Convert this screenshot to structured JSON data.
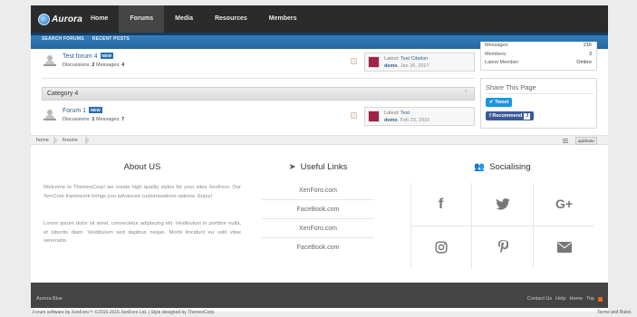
{
  "header": {
    "logo_text": "Aurora",
    "nav": [
      "Home",
      "Forums",
      "Media",
      "Resources",
      "Members"
    ],
    "active_nav": "Forums",
    "subnav": [
      "SEARCH FORUMS",
      "RECENT POSTS"
    ]
  },
  "forums": [
    {
      "title": "Test forum 4",
      "badge": "NEW",
      "discussions_label": "Discussions:",
      "discussions": "2",
      "messages_label": "Messages:",
      "messages": "4",
      "latest_label": "Latest:",
      "latest_thread": "Test Citation",
      "latest_user": "demo",
      "latest_date": "Jan 26, 2017"
    },
    {
      "title": "Forum 1",
      "badge": "NEW",
      "discussions_label": "Discussions:",
      "discussions": "1",
      "messages_label": "Messages:",
      "messages": "7",
      "latest_label": "Latest:",
      "latest_thread": "Test",
      "latest_user": "demo",
      "latest_date": "Feb 23, 2016"
    }
  ],
  "category": {
    "title": "Category 4"
  },
  "sidebar": {
    "stats": [
      {
        "label": "Messages:",
        "value": "216"
      },
      {
        "label": "Members:",
        "value": "3"
      },
      {
        "label": "Latest Member:",
        "value": "Ombre"
      }
    ],
    "share_title": "Share This Page",
    "tweet_label": "Tweet",
    "fb_label": "Recommend",
    "fb_count": "3"
  },
  "breadcrumb": {
    "items": [
      "home",
      "forums"
    ],
    "quicknav": "quicknav"
  },
  "about": {
    "title": "About US",
    "para1": "Welcome to ThemesCorp! we create high quality styles for your sites XenForo. Our XenCore framework brings you advanced customizations options. Enjoy!",
    "para2": "Lorem ipsum dolor sit amet, consectetur adipiscing elit. Vestibulum in porttitor nulla, et lobortis diam. Vestibulum sed dapibus neque. Morbi tincidunt eu velit vitae venenatis."
  },
  "useful_links": {
    "title": "Useful Links",
    "items": [
      "XenForo.com",
      "FaceBook.com",
      "XenForo.com",
      "FaceBook.com"
    ]
  },
  "social": {
    "title": "Socialising",
    "icons": [
      "facebook-icon",
      "twitter-icon",
      "google-plus-icon",
      "instagram-icon",
      "pinterest-icon",
      "email-icon"
    ]
  },
  "footer": {
    "style_name": "Aurora Blue",
    "links": [
      "Contact Us",
      "Help",
      "Home",
      "Top"
    ],
    "copyright": "Forum software by XenForo™ ©2010-2016 XenForo Ltd. | Style designed by ThemesCorp.",
    "terms": "Terms and Rules"
  }
}
